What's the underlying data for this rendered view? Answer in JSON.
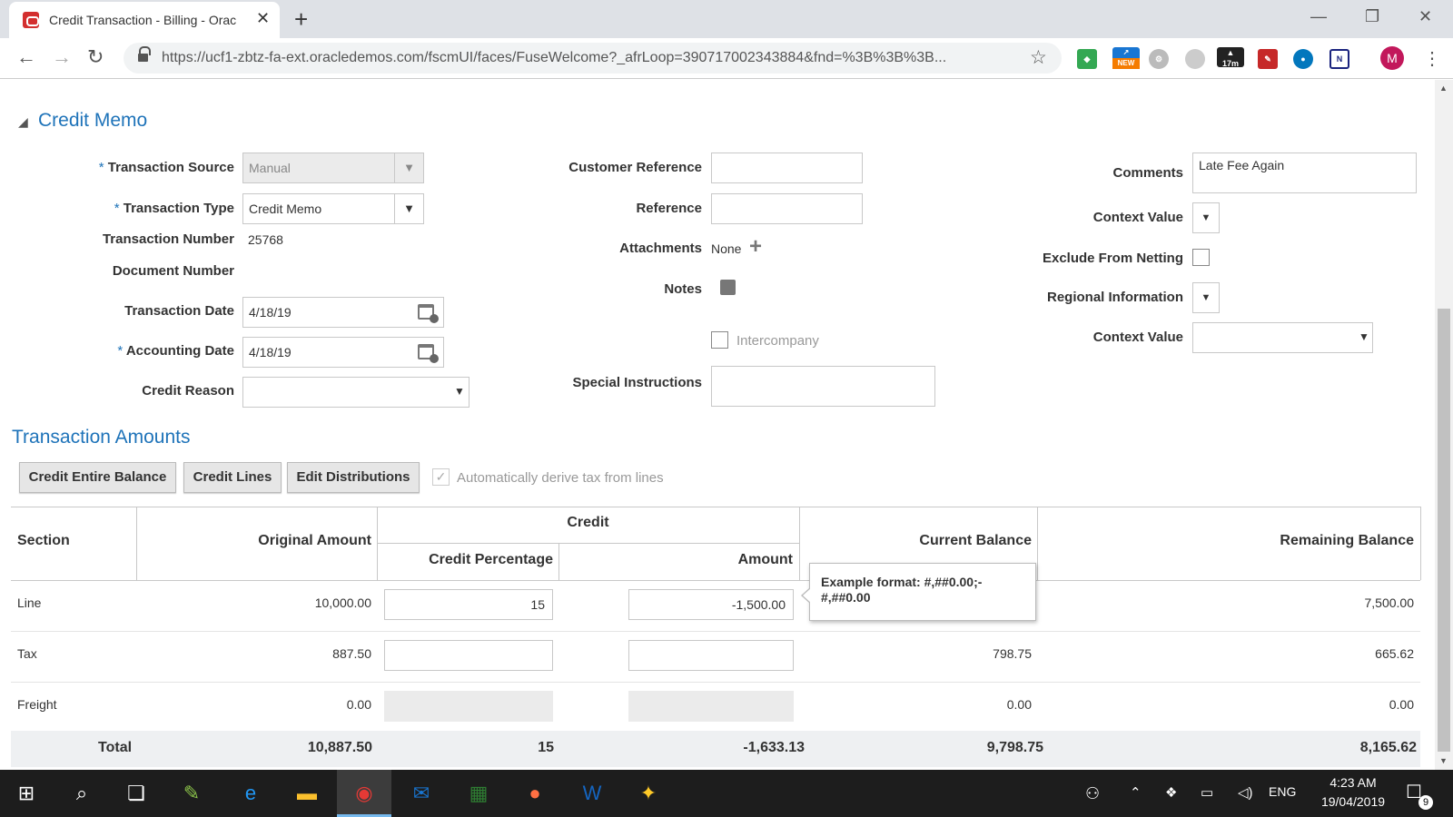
{
  "browser": {
    "tab_title": "Credit Transaction - Billing - Orac",
    "url": "https://ucf1-zbtz-fa-ext.oracledemos.com/fscmUI/faces/FuseWelcome?_afrLoop=390717002343884&fnd=%3B%3B%3B...",
    "ext_badge_new": "NEW",
    "ext_badge_timer": "17m",
    "avatar_initial": "M"
  },
  "credit_memo": {
    "title": "Credit Memo",
    "required_mark": "*",
    "transaction_source_label": "Transaction Source",
    "transaction_source_value": "Manual",
    "transaction_type_label": "Transaction Type",
    "transaction_type_value": "Credit Memo",
    "transaction_number_label": "Transaction Number",
    "transaction_number_value": "25768",
    "document_number_label": "Document Number",
    "transaction_date_label": "Transaction Date",
    "transaction_date_value": "4/18/19",
    "accounting_date_label": "Accounting Date",
    "accounting_date_value": "4/18/19",
    "credit_reason_label": "Credit Reason",
    "customer_reference_label": "Customer Reference",
    "reference_label": "Reference",
    "attachments_label": "Attachments",
    "attachments_value": "None",
    "notes_label": "Notes",
    "intercompany_label": "Intercompany",
    "special_instructions_label": "Special Instructions",
    "comments_label": "Comments",
    "comments_value": "Late Fee Again",
    "context_value_label": "Context Value",
    "exclude_netting_label": "Exclude From Netting",
    "regional_info_label": "Regional Information",
    "context_value2_label": "Context Value"
  },
  "amounts": {
    "title": "Transaction Amounts",
    "btn_credit_entire": "Credit Entire Balance",
    "btn_credit_lines": "Credit Lines",
    "btn_edit_dist": "Edit Distributions",
    "auto_tax_label": "Automatically derive tax from lines",
    "headers": {
      "section": "Section",
      "original": "Original Amount",
      "credit": "Credit",
      "credit_pct": "Credit Percentage",
      "amount": "Amount",
      "current": "Current Balance",
      "remaining": "Remaining Balance"
    },
    "rows": [
      {
        "section": "Line",
        "original": "10,000.00",
        "pct": "15",
        "amount": "-1,500.00",
        "current": "",
        "remaining": "7,500.00"
      },
      {
        "section": "Tax",
        "original": "887.50",
        "pct": "",
        "amount": "",
        "current": "798.75",
        "remaining": "665.62"
      },
      {
        "section": "Freight",
        "original": "0.00",
        "pct": "",
        "amount": "",
        "current": "0.00",
        "remaining": "0.00"
      }
    ],
    "total": {
      "section": "Total",
      "original": "10,887.50",
      "pct": "15",
      "amount": "-1,633.13",
      "current": "9,798.75",
      "remaining": "8,165.62"
    },
    "tooltip": "Example format: #,##0.00;-#,##0.00"
  },
  "taskbar": {
    "lang": "ENG",
    "time": "4:23 AM",
    "date": "19/04/2019",
    "notif_count": "9"
  }
}
